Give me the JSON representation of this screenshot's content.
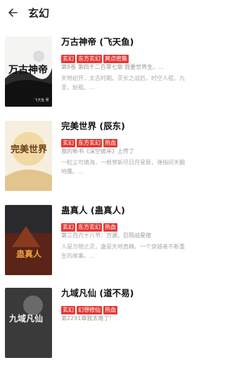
{
  "header": {
    "title": "玄幻"
  },
  "books": [
    {
      "name": "万古神帝 (飞天鱼)",
      "tags": [
        "玄幻",
        "东方玄幻",
        "爽点密集"
      ],
      "chapter": "第8卷 第四千二百零七章 我要世界生、...",
      "desc": "天地初开，太古时期。灵长之战后，时空人祖、九圣、始祖、..."
    },
    {
      "name": "完美世界 (辰东)",
      "tags": [
        "玄幻",
        "东方玄幻",
        "热血"
      ],
      "chapter": "我的新书《深空彼岸》上传了",
      "desc": "一粒尘可填海，一根草斩尽日月星辰，弹指间天翻地覆。..."
    },
    {
      "name": "蛊真人 (蛊真人)",
      "tags": [
        "玄幻",
        "东方玄幻",
        "热血"
      ],
      "chapter": "第三百六十八节：方源、巨阳战星宿",
      "desc": "人是万物之灵，蛊是天地真精。一个穿越者不断重生的故事。..."
    },
    {
      "name": "九域凡仙 (道不易)",
      "tags": [
        "玄幻",
        "幻想修仙",
        "热血"
      ],
      "chapter": "第2291章我太难了!",
      "desc": ""
    }
  ],
  "covers": [
    {
      "text": "万古神帝",
      "author": "飞天鱼 著"
    },
    {
      "text": "完美世界",
      "author": ""
    },
    {
      "text": "蛊真人",
      "author": ""
    },
    {
      "text": "九域凡仙",
      "author": ""
    }
  ],
  "icons": {
    "back": "arrow-left-icon"
  },
  "colors": {
    "tag": "#e53935"
  }
}
